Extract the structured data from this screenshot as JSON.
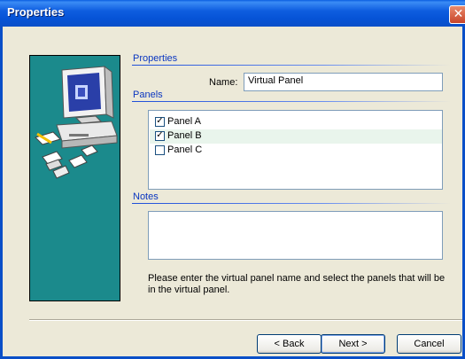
{
  "window": {
    "title": "Properties",
    "close_glyph": "✕"
  },
  "properties_section": {
    "header": "Properties",
    "name_label": "Name:",
    "name_value": "Virtual Panel"
  },
  "panels_section": {
    "header": "Panels",
    "items": [
      {
        "label": "Panel A",
        "checked": true
      },
      {
        "label": "Panel B",
        "checked": true
      },
      {
        "label": "Panel C",
        "checked": false
      }
    ]
  },
  "notes_section": {
    "header": "Notes",
    "value": ""
  },
  "help_text": "Please enter the virtual panel name and select the panels that will be in the virtual panel.",
  "buttons": {
    "back": "< Back",
    "next": "Next >",
    "cancel": "Cancel"
  },
  "colors": {
    "title_bar": "#0a5fe0",
    "side_panel": "#1b8a8c",
    "section_header": "#0a36c0",
    "dialog_bg": "#ece9d8"
  },
  "icons": [
    "computer-icon",
    "documents-icon",
    "close-icon",
    "checkbox-checked-icon"
  ]
}
